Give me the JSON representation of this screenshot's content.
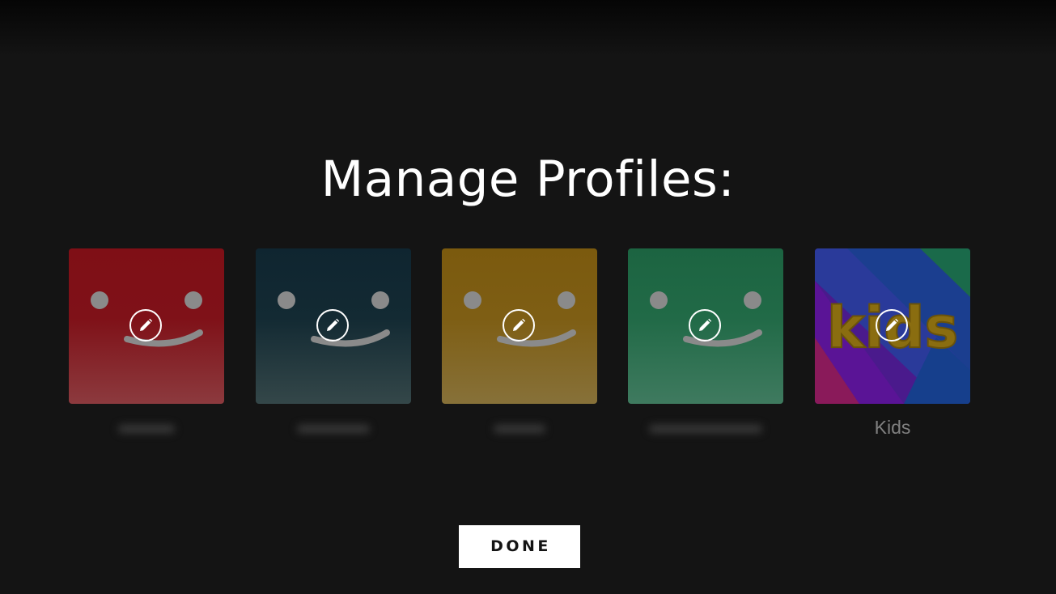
{
  "header": {
    "title": "Manage Profiles:"
  },
  "profiles": [
    {
      "name": "",
      "name_hidden": true,
      "avatar_icon": "smiley-face-icon",
      "avatar_color": "#7d1016",
      "edit_icon": "pencil-icon"
    },
    {
      "name": "",
      "name_hidden": true,
      "avatar_icon": "smiley-face-icon",
      "avatar_color": "#10262e",
      "edit_icon": "pencil-icon"
    },
    {
      "name": "",
      "name_hidden": true,
      "avatar_icon": "smiley-face-icon",
      "avatar_color": "#7a5a0f",
      "edit_icon": "pencil-icon"
    },
    {
      "name": "",
      "name_hidden": true,
      "avatar_icon": "smiley-face-icon",
      "avatar_color": "#1d6440",
      "edit_icon": "pencil-icon"
    },
    {
      "name": "Kids",
      "name_hidden": false,
      "avatar_icon": "kids-logo-icon",
      "avatar_text": "kids",
      "avatar_color": "#3a1a8a",
      "edit_icon": "pencil-icon"
    }
  ],
  "actions": {
    "done_label": "DONE"
  },
  "colors": {
    "background": "#141414",
    "title": "#ffffff",
    "profile_name": "#808080",
    "button_bg": "#ffffff",
    "button_text": "#141414"
  }
}
